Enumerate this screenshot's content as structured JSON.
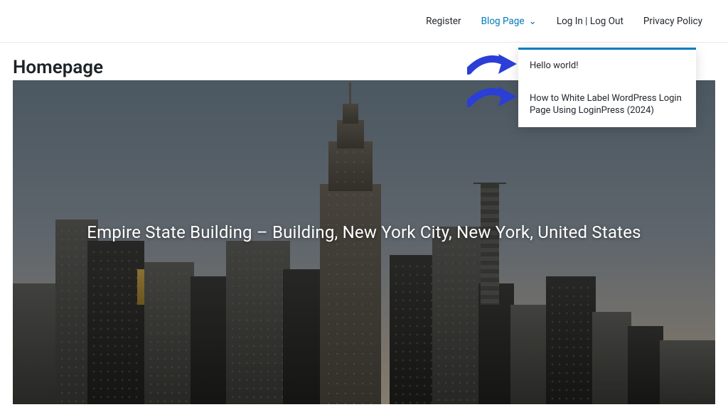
{
  "nav": {
    "items": [
      {
        "label": "Register"
      },
      {
        "label": "Blog Page",
        "active": true,
        "hasSubmenu": true
      },
      {
        "label": "Log In | Log Out"
      },
      {
        "label": "Privacy Policy"
      }
    ]
  },
  "page": {
    "title": "Homepage"
  },
  "dropdown": {
    "items": [
      {
        "label": "Hello world!"
      },
      {
        "label": "How to White Label WordPress Login Page Using LoginPress (2024)"
      }
    ]
  },
  "hero": {
    "title": "Empire State Building – Building, New York City, New York, United States"
  },
  "icons": {
    "chevron": "⌄"
  },
  "annotation": {
    "arrowColor": "#2b3ed6"
  }
}
